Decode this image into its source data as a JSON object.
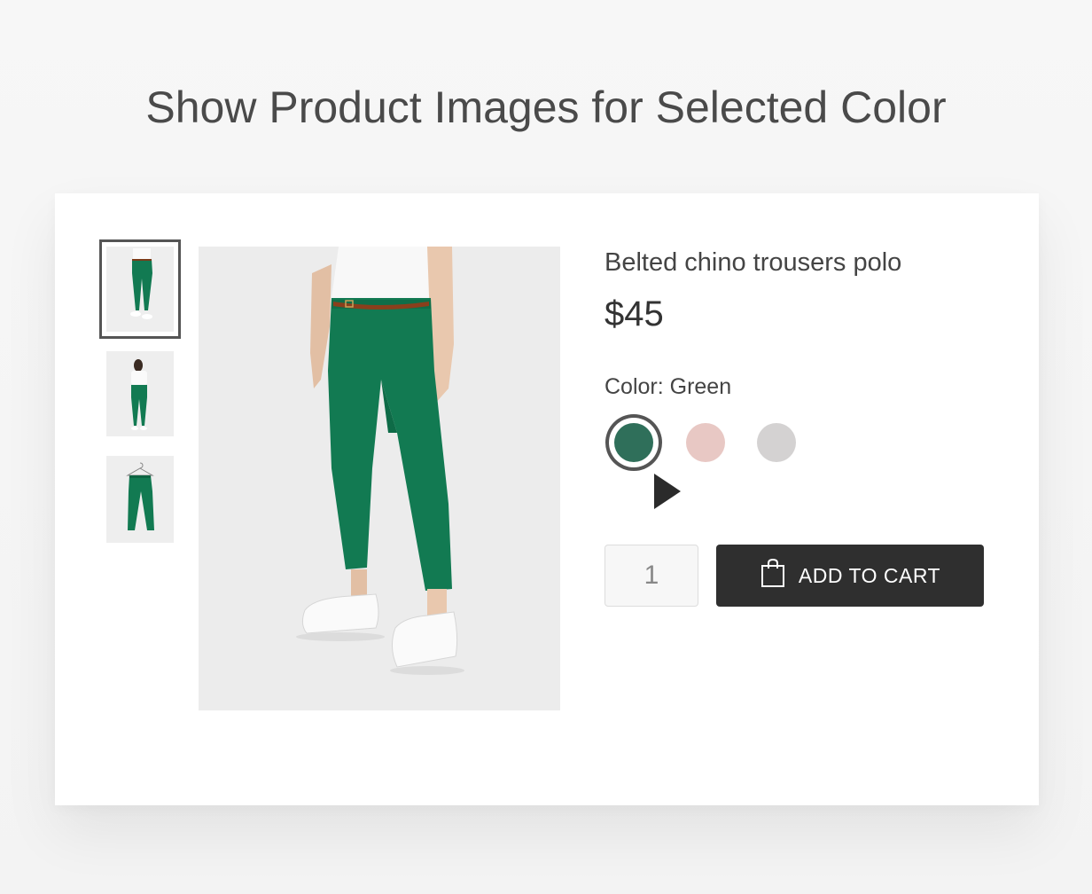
{
  "headline": "Show Product Images for Selected Color",
  "product": {
    "title": "Belted chino trousers polo",
    "price": "$45",
    "color_label": "Color: Green",
    "swatches": [
      {
        "name": "Green",
        "hex": "#2f6f5a",
        "selected": true
      },
      {
        "name": "Pink",
        "hex": "#e8c8c4",
        "selected": false
      },
      {
        "name": "Gray",
        "hex": "#d4d2d2",
        "selected": false
      }
    ],
    "thumbnails": [
      "front-view",
      "back-view",
      "flat-lay-on-hanger"
    ],
    "selected_thumbnail": 0
  },
  "cart": {
    "quantity": "1",
    "button_label": "ADD TO CART",
    "button_icon": "shopping-bag-icon"
  },
  "colors": {
    "trouser": "#127a52",
    "button_bg": "#2f2f2f"
  }
}
